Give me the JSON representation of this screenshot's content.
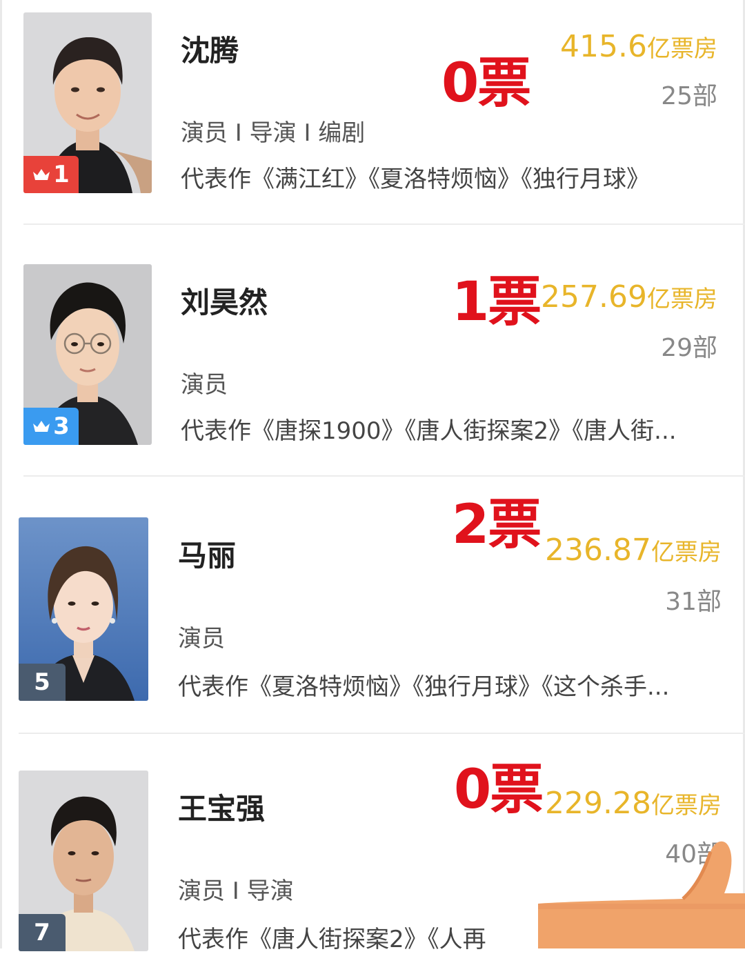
{
  "ranking": [
    {
      "name": "沈腾",
      "rank": "1",
      "rank_style": "gold",
      "roles": "演员 I 导演 I 编剧",
      "works": "代表作《满江红》《夏洛特烦恼》《独行月球》",
      "votes": "0票",
      "box_office_value": "415.6",
      "box_office_unit": "亿票房",
      "film_count": "25部"
    },
    {
      "name": "刘昊然",
      "rank": "3",
      "rank_style": "blue",
      "roles": "演员",
      "works": "代表作《唐探1900》《唐人街探案2》《唐人街...",
      "votes": "1票",
      "box_office_value": "257.69",
      "box_office_unit": "亿票房",
      "film_count": "29部"
    },
    {
      "name": "马丽",
      "rank": "5",
      "rank_style": "gray",
      "roles": "演员",
      "works": "代表作《夏洛特烦恼》《独行月球》《这个杀手...",
      "votes": "2票",
      "box_office_value": "236.87",
      "box_office_unit": "亿票房",
      "film_count": "31部"
    },
    {
      "name": "王宝强",
      "rank": "7",
      "rank_style": "gray",
      "roles": "演员 I 导演",
      "works": "代表作《唐人街探案2》《人再",
      "votes": "0票",
      "box_office_value": "229.28",
      "box_office_unit": "亿票房",
      "film_count": "40部"
    }
  ],
  "colors": {
    "vote_red": "#e0121c",
    "box_office_gold": "#e8b52a",
    "rank_gold": "#e8423a",
    "rank_blue": "#3a9bf0",
    "rank_gray": "#4a5b6f"
  },
  "icons": {
    "crown": "crown-icon",
    "thumb": "thumbs-up-emoji"
  }
}
